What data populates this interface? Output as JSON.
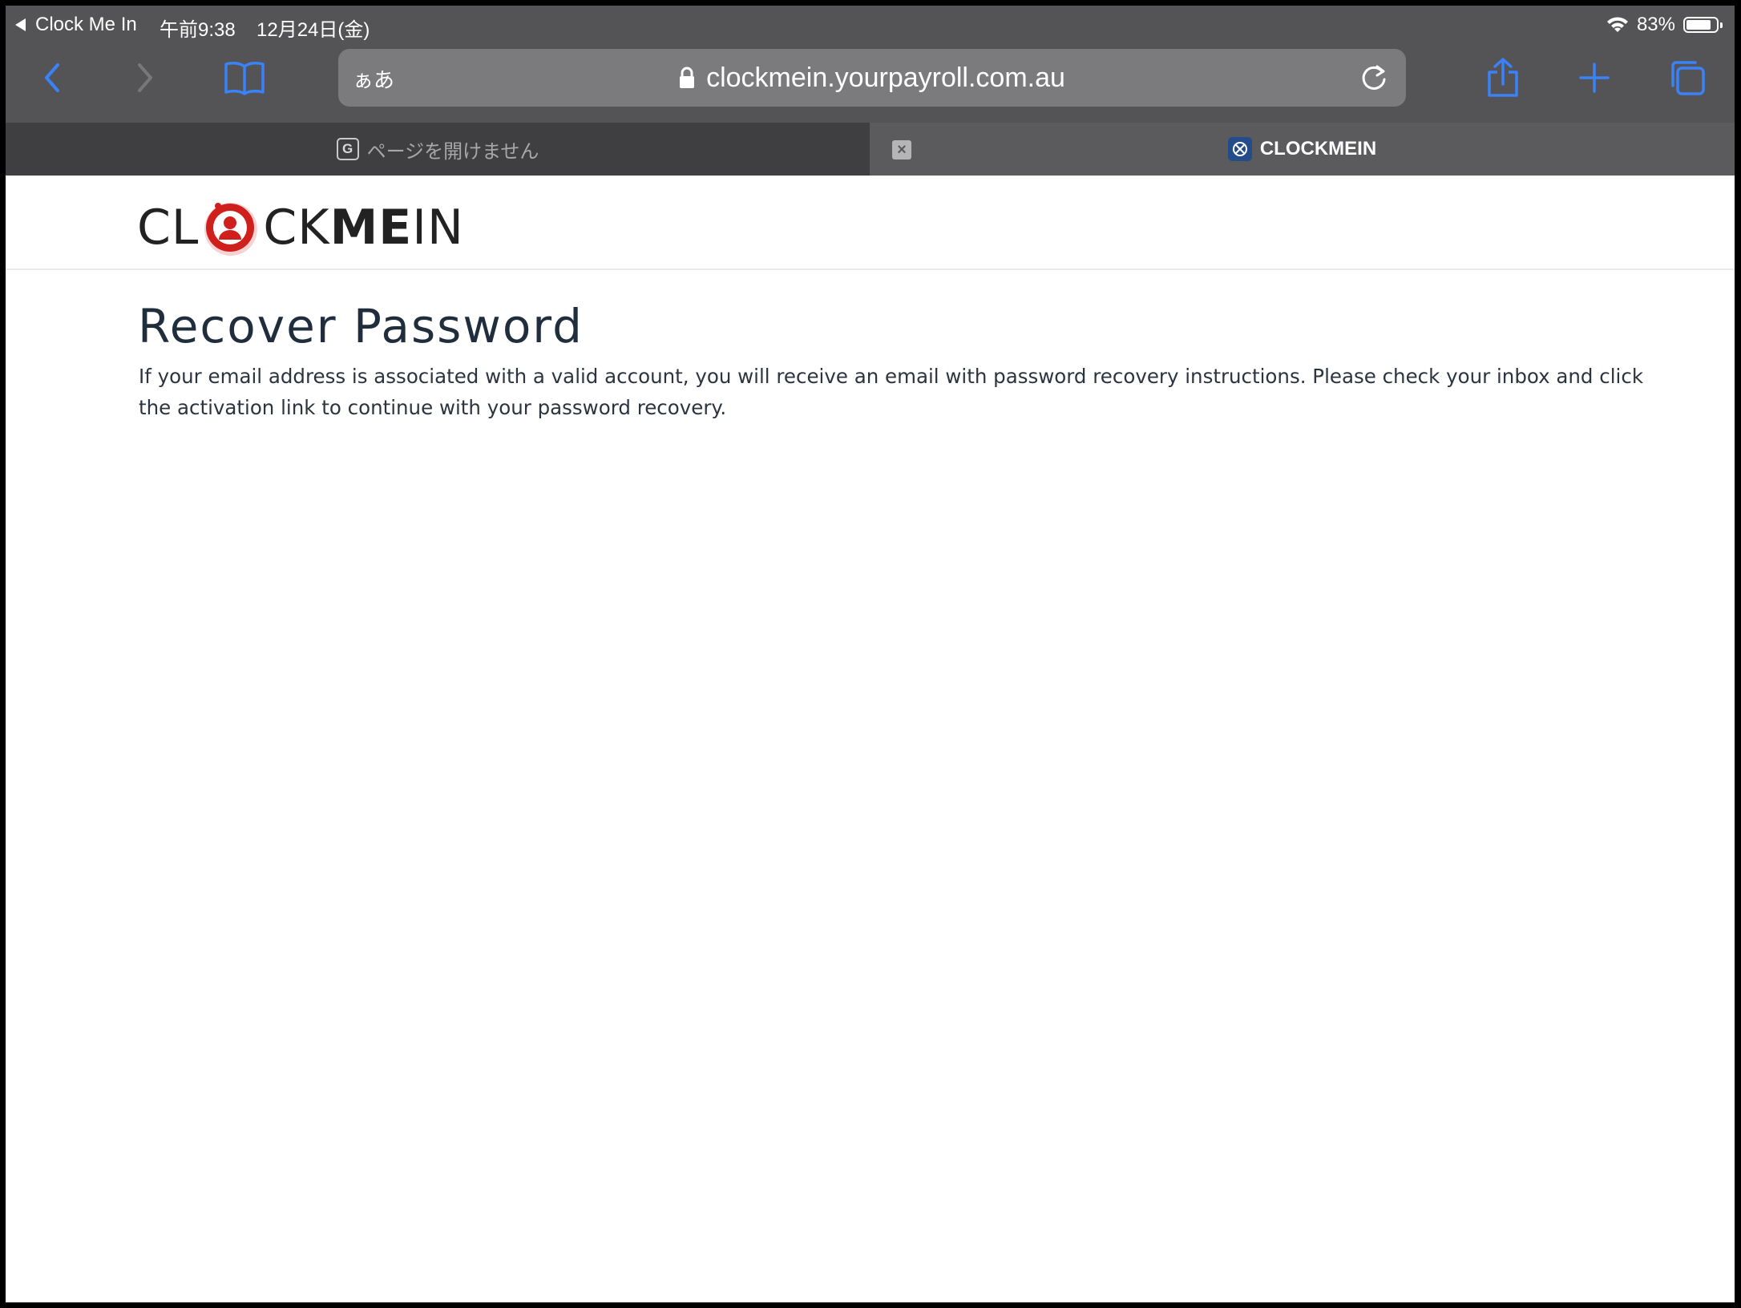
{
  "status_bar": {
    "back_app": "Clock Me In",
    "time": "午前9:38",
    "date": "12月24日(金)",
    "battery": "83%",
    "battery_level": 0.83
  },
  "toolbar": {
    "text_size_label": "ぁあ",
    "url": "clockmein.yourpayroll.com.au",
    "accent_color": "#3a82f7"
  },
  "tabs": [
    {
      "label": "ページを開けません",
      "favicon": "G",
      "active": false
    },
    {
      "label": "CLOCKMEIN",
      "active": true
    }
  ],
  "logo": {
    "part1": "CL",
    "part2": "CK",
    "part3": "ME",
    "part4": "IN",
    "brand_color": "#d0201e"
  },
  "main": {
    "title": "Recover Password",
    "description": "If your email address is associated with a valid account, you will receive an email with password recovery instructions. Please check your inbox and click the activation link to continue with your password recovery."
  }
}
